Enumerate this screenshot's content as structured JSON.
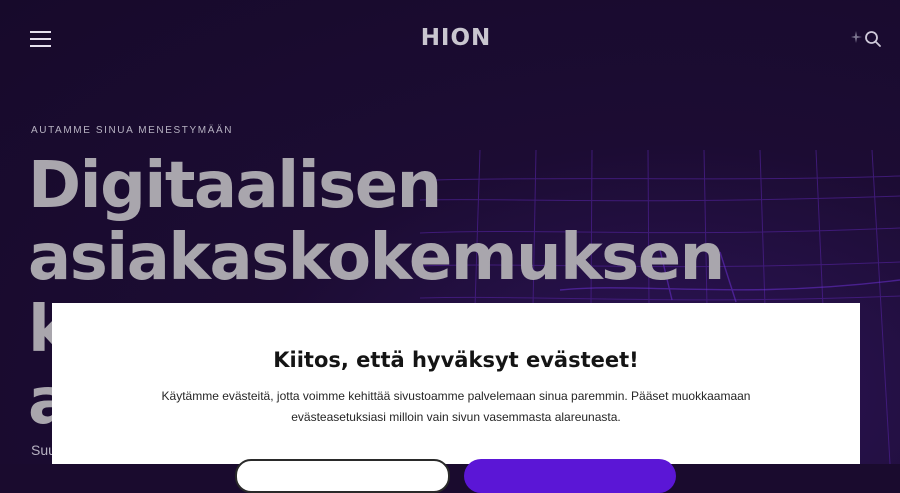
{
  "header": {
    "logo": "HION"
  },
  "hero": {
    "eyebrow": "AUTAMME SINUA MENESTYMÄÄN",
    "headline_lines": [
      "Digitaalisen",
      "asiakaskokemuksen",
      "k",
      "a"
    ],
    "subtext": "Suu"
  },
  "cookie_banner": {
    "title": "Kiitos, että hyväksyt evästeet!",
    "body": "Käytämme evästeitä, jotta voimme kehittää sivustoamme palvelemaan sinua paremmin. Pääset muokkaamaan evästeasetuksiasi milloin vain sivun vasemmasta alareunasta."
  },
  "icons": {
    "menu": "hamburger-menu-icon",
    "sparkle": "sparkle-icon",
    "search": "search-icon"
  },
  "colors": {
    "background": "#1a0b2e",
    "grid_lines": "#4a1f8c",
    "headline": "#a9a6ad",
    "primary_button": "#5b16d6"
  }
}
